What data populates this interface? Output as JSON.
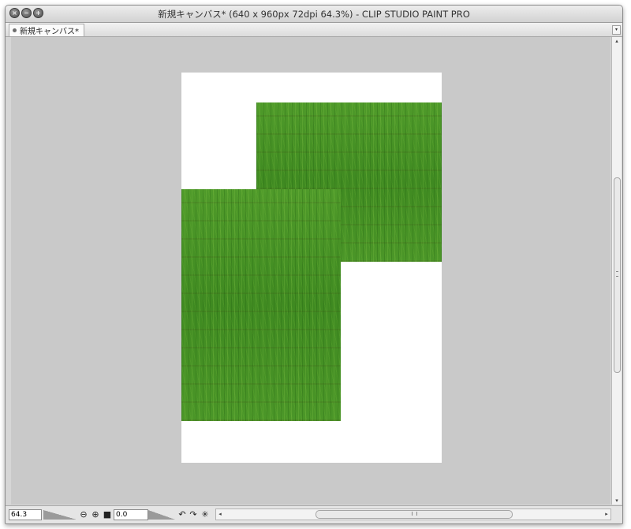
{
  "window": {
    "title": "新規キャンバス* (640 x 960px 72dpi 64.3%)  - CLIP STUDIO PAINT PRO"
  },
  "tab": {
    "label": "新規キャンバス*",
    "menu_icon": "triangle-down-icon"
  },
  "status": {
    "zoom_value": "64.3",
    "rotation_value": "0.0"
  },
  "icons": {
    "close": "×",
    "minimize": "−",
    "zoom": "+",
    "zoom_out": "⊖",
    "zoom_in": "⊕",
    "fit": "■",
    "rotate_left": "↶",
    "rotate_right": "↷",
    "reset": "✳",
    "arrow_left": "◂",
    "arrow_right": "▸",
    "arrow_up": "▴",
    "arrow_down": "▾"
  },
  "colors": {
    "canvas_bg": "#c9c9c9",
    "page_bg": "#ffffff",
    "grass": "#4a9326"
  }
}
